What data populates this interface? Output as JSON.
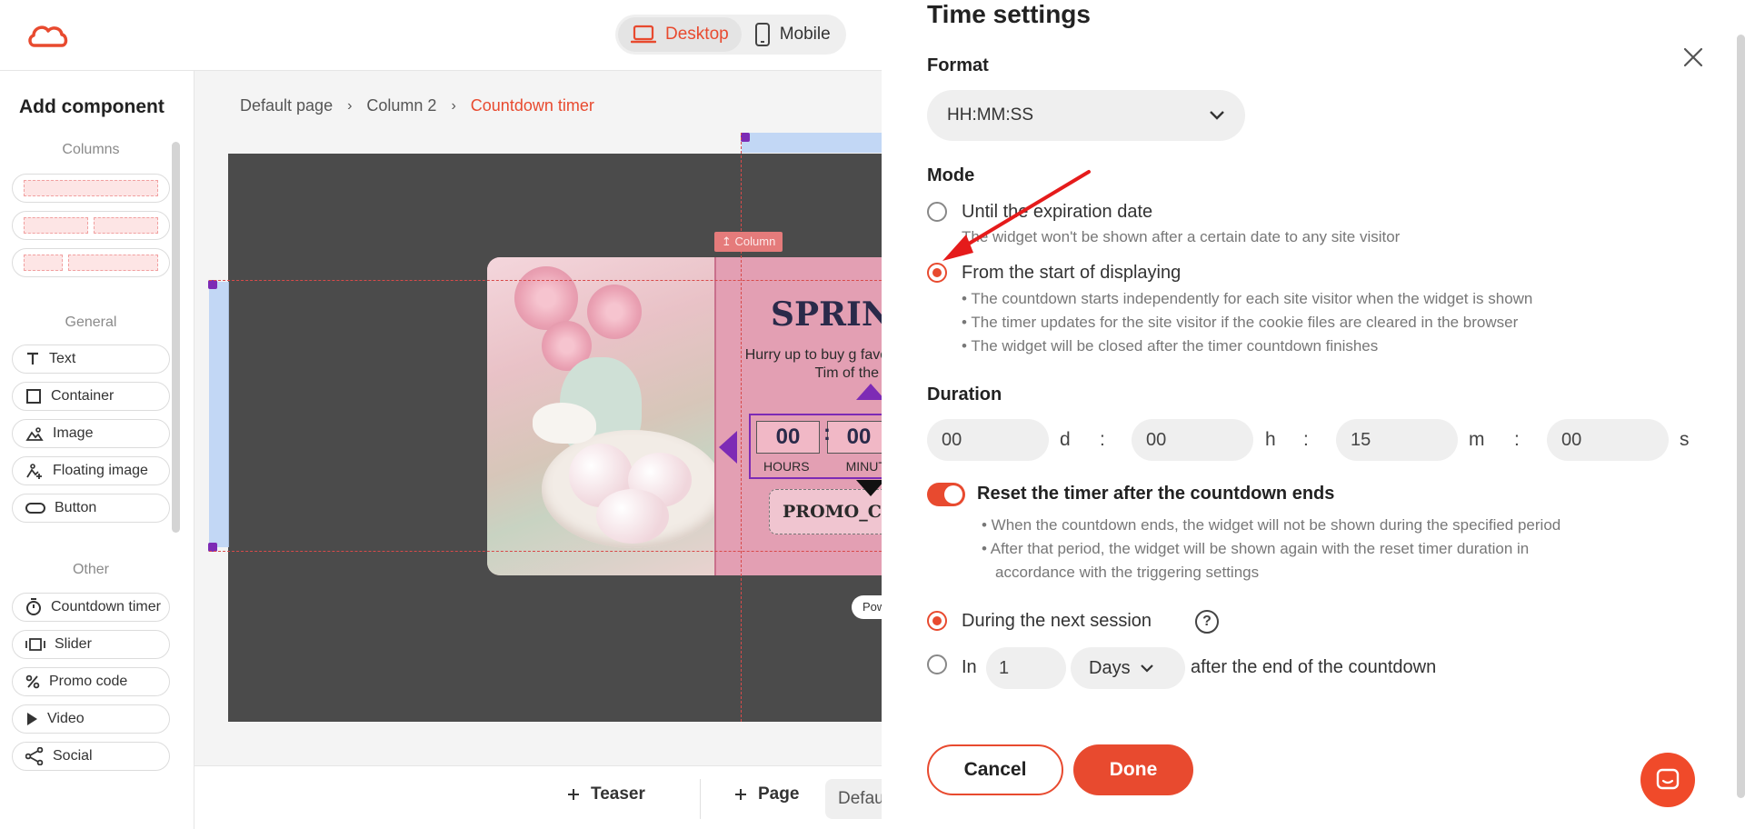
{
  "topbar": {
    "devices": [
      {
        "label": "Desktop",
        "icon": "laptop-icon",
        "active": true
      },
      {
        "label": "Mobile",
        "icon": "phone-icon",
        "active": false
      }
    ]
  },
  "sidebar": {
    "title": "Add component",
    "sections": {
      "columns": "Columns",
      "general": "General",
      "other": "Other"
    },
    "general_items": [
      {
        "label": "Text",
        "icon": "text-icon"
      },
      {
        "label": "Container",
        "icon": "square-icon"
      },
      {
        "label": "Image",
        "icon": "image-icon"
      },
      {
        "label": "Floating image",
        "icon": "floating-image-icon"
      },
      {
        "label": "Button",
        "icon": "button-icon"
      }
    ],
    "other_items": [
      {
        "label": "Countdown timer",
        "icon": "stopwatch-icon"
      },
      {
        "label": "Slider",
        "icon": "slider-icon"
      },
      {
        "label": "Promo code",
        "icon": "percent-icon"
      },
      {
        "label": "Video",
        "icon": "play-icon"
      },
      {
        "label": "Social",
        "icon": "share-icon"
      }
    ]
  },
  "breadcrumb": {
    "items": [
      "Default page",
      "Column 2",
      "Countdown timer"
    ],
    "separator": "›"
  },
  "canvas": {
    "column_tag": "↥ Column",
    "widget": {
      "title": "SPRING",
      "text": "Hurry up to buy g favorable price! Tim of the c",
      "timer": {
        "hours": "00",
        "minutes": "00",
        "colon": ":",
        "label_hours": "HOURS",
        "label_minutes": "MINUT"
      },
      "promo_code": "PROMO_CO"
    },
    "powered": "Pow"
  },
  "bottom_bar": {
    "teaser": "Teaser",
    "page": "Page",
    "default_select": "Defau"
  },
  "panel": {
    "title": "Time settings",
    "format_label": "Format",
    "format_value": "HH:MM:SS",
    "mode_label": "Mode",
    "mode_options": [
      {
        "label": "Until the expiration date",
        "checked": false,
        "hints": [
          "The widget won't be shown after a certain date to any site visitor"
        ]
      },
      {
        "label": "From the start of displaying",
        "checked": true,
        "hints": [
          "• The countdown starts independently for each site visitor when the widget is shown",
          "• The timer updates for the site visitor if the cookie files are cleared in the browser",
          "• The widget will be closed after the timer countdown finishes"
        ]
      }
    ],
    "duration_label": "Duration",
    "duration": [
      {
        "value": "00",
        "unit": "d"
      },
      {
        "value": "00",
        "unit": "h"
      },
      {
        "value": "15",
        "unit": "m"
      },
      {
        "value": "00",
        "unit": "s"
      }
    ],
    "duration_sep": ":",
    "reset_label": "Reset the timer after the countdown ends",
    "reset_on": true,
    "reset_hints": [
      "• When the countdown ends, the widget will not be shown during the specified period",
      "• After that period, the widget will be shown again with the reset timer duration in",
      "accordance with the triggering settings"
    ],
    "session_option": "During the next session",
    "help_symbol": "?",
    "in_option": {
      "prefix": "In",
      "value": "1",
      "unit": "Days",
      "suffix": "after the end of the countdown"
    },
    "cancel": "Cancel",
    "done": "Done"
  },
  "colors": {
    "accent": "#e84a2f",
    "purple": "#7d2bb5"
  }
}
